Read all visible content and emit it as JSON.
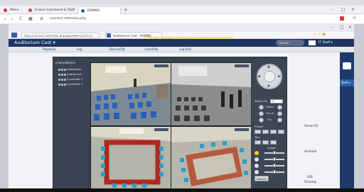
{
  "outer_browser": {
    "tabs": [
      {
        "label": "Menu"
      },
      {
        "label": "Evolve Command & Staff"
      },
      {
        "label": "DSMMS"
      }
    ],
    "url": "connect.net/index.php",
    "window_controls": [
      "–",
      "□",
      "✕"
    ]
  },
  "inner_browser": {
    "url": "http://connect.net/index.php/app/external?id=3",
    "tab_label": "Auditorium Cast - DSMMS",
    "notification": "voiceCloud 7.0.73 is available. Get more information on how to update.",
    "window_controls": [
      "–",
      "□",
      "✕"
    ]
  },
  "app": {
    "title": "Auditorium Cast ▾",
    "search_placeholder": "Search",
    "user_label": "IT Staff ▾",
    "nav": [
      "Playback",
      "Log",
      "DeviceCfg",
      "LocalCfg",
      "Log Out"
    ],
    "right_tab_label": "Staff ▾"
  },
  "tree": {
    "header": "Surveillance",
    "items": [
      "Auditorium",
      "Auditorium",
      "Syndicate 1",
      "Syndicate 2"
    ]
  },
  "cameras": [
    {
      "label": "Camera 01",
      "scene": "auditorium-color"
    },
    {
      "label": "Camera 02",
      "scene": "auditorium-mono"
    },
    {
      "label": "Camera 03",
      "scene": "syndicate-1"
    },
    {
      "label": "Camera 04",
      "scene": "syndicate-2"
    }
  ],
  "ptz": {
    "speed_label": "Step(1-8)",
    "speed_value": "4",
    "zoom_label": "Zoom",
    "focus_label": "Focus",
    "iris_label": "Iris",
    "preset_label": "Preset",
    "tour_label": "Tour",
    "image_label": "Image",
    "default_button": "Default"
  },
  "info_panel": {
    "serial_label": "Serial ID",
    "platform_label": "Android",
    "ios_label": "IOS",
    "closing_label": "Closing"
  },
  "colors": {
    "app_header": "#1e3561",
    "panel": "#39424f",
    "sidebar_right": "#1d3a6b",
    "notification": "#f6e27c"
  }
}
